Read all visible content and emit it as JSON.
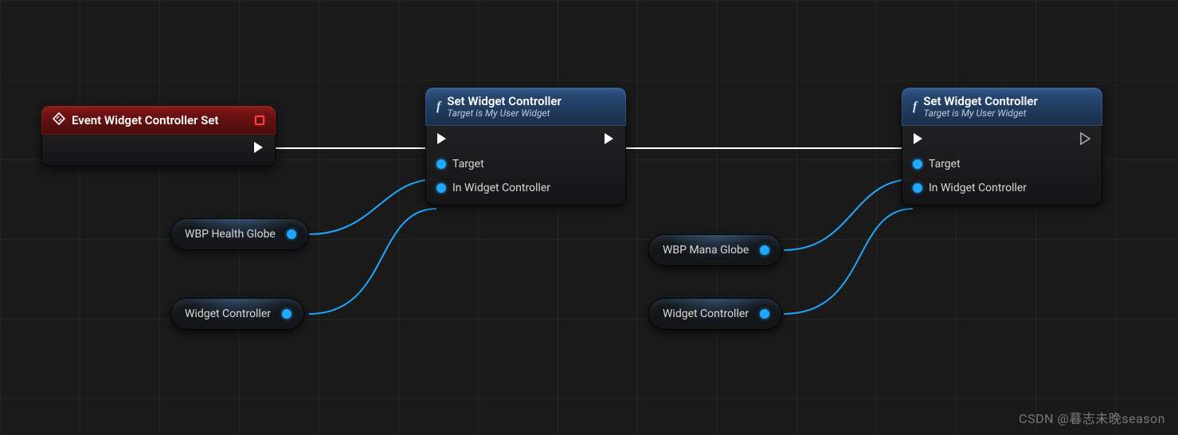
{
  "colors": {
    "exec_wire": "#ffffff",
    "data_wire": "#1fa8ff"
  },
  "watermark": "CSDN @暮志未晚season",
  "event_node": {
    "title": "Event Widget Controller Set",
    "icon": "diamond-arrows-icon",
    "delegate_pin": "delegate-out",
    "exec_out": "exec-out"
  },
  "func_node_1": {
    "title": "Set Widget Controller",
    "subtitle": "Target is My User Widget",
    "icon": "function-f-icon",
    "pins": {
      "exec_in": "exec-in",
      "exec_out": "exec-out",
      "target": "Target",
      "in_widget_controller": "In Widget Controller"
    }
  },
  "func_node_2": {
    "title": "Set Widget Controller",
    "subtitle": "Target is My User Widget",
    "icon": "function-f-icon",
    "pins": {
      "exec_in": "exec-in",
      "exec_out": "exec-out",
      "target": "Target",
      "in_widget_controller": "In Widget Controller"
    }
  },
  "pills": {
    "health": {
      "label": "WBP Health Globe"
    },
    "wc1": {
      "label": "Widget Controller"
    },
    "mana": {
      "label": "WBP Mana Globe"
    },
    "wc2": {
      "label": "Widget Controller"
    }
  },
  "wires": [
    {
      "type": "exec",
      "from": "event.exec_out",
      "to": "func1.exec_in"
    },
    {
      "type": "exec",
      "from": "func1.exec_out",
      "to": "func2.exec_in"
    },
    {
      "type": "data",
      "from": "pill.health.out",
      "to": "func1.target"
    },
    {
      "type": "data",
      "from": "pill.wc1.out",
      "to": "func1.in_widget_controller"
    },
    {
      "type": "data",
      "from": "pill.mana.out",
      "to": "func2.target"
    },
    {
      "type": "data",
      "from": "pill.wc2.out",
      "to": "func2.in_widget_controller"
    }
  ]
}
